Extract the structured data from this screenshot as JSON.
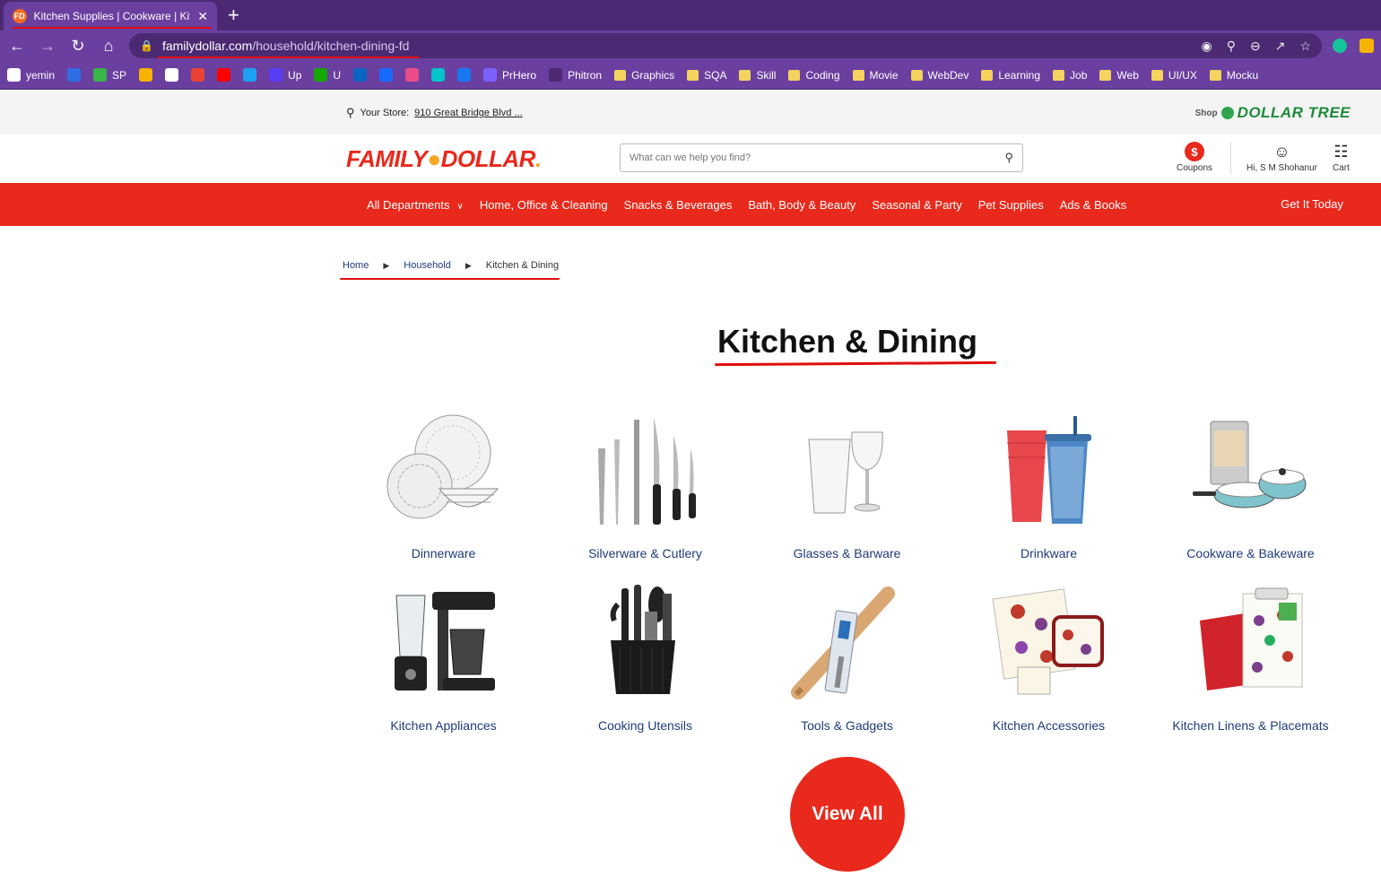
{
  "browser": {
    "tab_title": "Kitchen Supplies | Cookware | Kitc",
    "tab_close": "✕",
    "new_tab": "+",
    "url_domain": "familydollar.com",
    "url_path": "/household/kitchen-dining-fd",
    "bookmarks": [
      {
        "label": "yemin",
        "icon": "ubuntu-icon",
        "color": "#ffffff"
      },
      {
        "label": "",
        "icon": "app-icon",
        "color": "#2f6fe4"
      },
      {
        "label": "SP",
        "icon": "sp-icon",
        "color": "#39b54a"
      },
      {
        "label": "",
        "icon": "keep-icon",
        "color": "#f6b400"
      },
      {
        "label": "",
        "icon": "github-icon",
        "color": "#ffffff"
      },
      {
        "label": "",
        "icon": "gmail-icon",
        "color": "#ea4335"
      },
      {
        "label": "",
        "icon": "youtube-icon",
        "color": "#ff0000"
      },
      {
        "label": "",
        "icon": "twitter-icon",
        "color": "#1da1f2"
      },
      {
        "label": "Up",
        "icon": "upwork-icon",
        "color": "#5a3df5"
      },
      {
        "label": "U",
        "icon": "upwork-green-icon",
        "color": "#14a800"
      },
      {
        "label": "",
        "icon": "linkedin-icon",
        "color": "#0a66c2"
      },
      {
        "label": "",
        "icon": "behance-icon",
        "color": "#1769ff"
      },
      {
        "label": "",
        "icon": "dribbble-icon",
        "color": "#ea4c89"
      },
      {
        "label": "",
        "icon": "canva-icon",
        "color": "#00c4cc"
      },
      {
        "label": "",
        "icon": "facebook-icon",
        "color": "#1877f2"
      },
      {
        "label": "PrHero",
        "icon": "prhero-icon",
        "color": "#7b61ff"
      },
      {
        "label": "Phitron",
        "icon": "phitron-icon",
        "color": "#4b2a73"
      }
    ],
    "folders": [
      "Graphics",
      "SQA",
      "Skill",
      "Coding",
      "Movie",
      "WebDev",
      "Learning",
      "Job",
      "Web",
      "UI/UX",
      "Mocku"
    ]
  },
  "store": {
    "label": "Your Store:",
    "address": "910 Great Bridge Blvd ...",
    "shop_label": "Shop",
    "dollar_tree": "DOLLAR TREE"
  },
  "header": {
    "logo_left": "FAMILY",
    "logo_right": "DOLLAR",
    "logo_dot": ".",
    "search_placeholder": "What can we help you find?",
    "coupons_icon": "$",
    "coupons": "Coupons",
    "user": "Hi, S M Shohanur",
    "cart": "Cart"
  },
  "nav": {
    "links": [
      "All Departments",
      "Home, Office & Cleaning",
      "Snacks & Beverages",
      "Bath, Body & Beauty",
      "Seasonal & Party",
      "Pet Supplies",
      "Ads & Books"
    ],
    "get_it_today": "Get It Today"
  },
  "breadcrumb": {
    "home": "Home",
    "household": "Household",
    "current": "Kitchen & Dining"
  },
  "page": {
    "title": "Kitchen & Dining",
    "view_all": "View All"
  },
  "categories": [
    {
      "label": "Dinnerware",
      "icon": "dinnerware"
    },
    {
      "label": "Silverware & Cutlery",
      "icon": "cutlery"
    },
    {
      "label": "Glasses & Barware",
      "icon": "glasses"
    },
    {
      "label": "Drinkware",
      "icon": "drinkware"
    },
    {
      "label": "Cookware & Bakeware",
      "icon": "cookware"
    },
    {
      "label": "Kitchen Appliances",
      "icon": "appliances"
    },
    {
      "label": "Cooking Utensils",
      "icon": "utensils"
    },
    {
      "label": "Tools & Gadgets",
      "icon": "gadgets"
    },
    {
      "label": "Kitchen Accessories",
      "icon": "accessories"
    },
    {
      "label": "Kitchen Linens & Placemats",
      "icon": "linens"
    }
  ],
  "colors": {
    "brand_red": "#e8291c",
    "chrome_purple": "#6b3fa0",
    "link_blue": "#1f3b7a",
    "annotation_red": "#e10d0d"
  }
}
